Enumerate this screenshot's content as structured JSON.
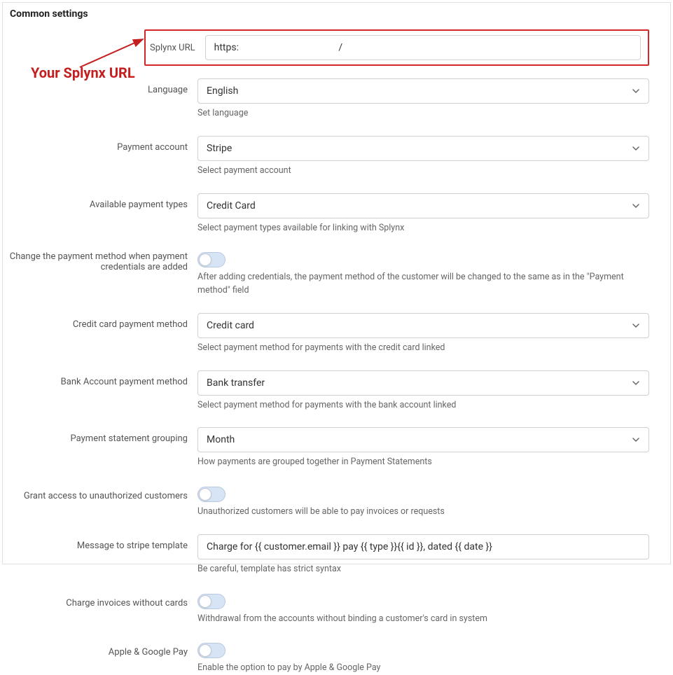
{
  "panel": {
    "title": "Common settings"
  },
  "annotation": {
    "text": "Your Splynx URL"
  },
  "fields": {
    "splynx_url": {
      "label": "Splynx URL",
      "value": "https:                                         /"
    },
    "language": {
      "label": "Language",
      "value": "English",
      "help": "Set language"
    },
    "payment_account": {
      "label": "Payment account",
      "value": "Stripe",
      "help": "Select payment account"
    },
    "available_payment_types": {
      "label": "Available payment types",
      "value": "Credit Card",
      "help": "Select payment types available for linking with Splynx"
    },
    "change_payment_method": {
      "label": "Change the payment method when payment credentials are added",
      "help": "After adding credentials, the payment method of the customer will be changed to the same as in the \"Payment method\" field"
    },
    "cc_payment_method": {
      "label": "Credit card payment method",
      "value": "Credit card",
      "help": "Select payment method for payments with the credit card linked"
    },
    "bank_payment_method": {
      "label": "Bank Account payment method",
      "value": "Bank transfer",
      "help": "Select payment method for payments with the bank account linked"
    },
    "statement_grouping": {
      "label": "Payment statement grouping",
      "value": "Month",
      "help": "How payments are grouped together in Payment Statements"
    },
    "grant_access": {
      "label": "Grant access to unauthorized customers",
      "help": "Unauthorized customers will be able to pay invoices or requests"
    },
    "stripe_template": {
      "label": "Message to stripe template",
      "value": "Charge for {{ customer.email }} pay {{ type }}{{ id }}, dated {{ date }}",
      "help": "Be careful, template has strict syntax"
    },
    "charge_without_cards": {
      "label": "Charge invoices without cards",
      "help": "Withdrawal from the accounts without binding a customer's card in system"
    },
    "apple_google_pay": {
      "label": "Apple & Google Pay",
      "help": "Enable the option to pay by Apple & Google Pay"
    }
  }
}
